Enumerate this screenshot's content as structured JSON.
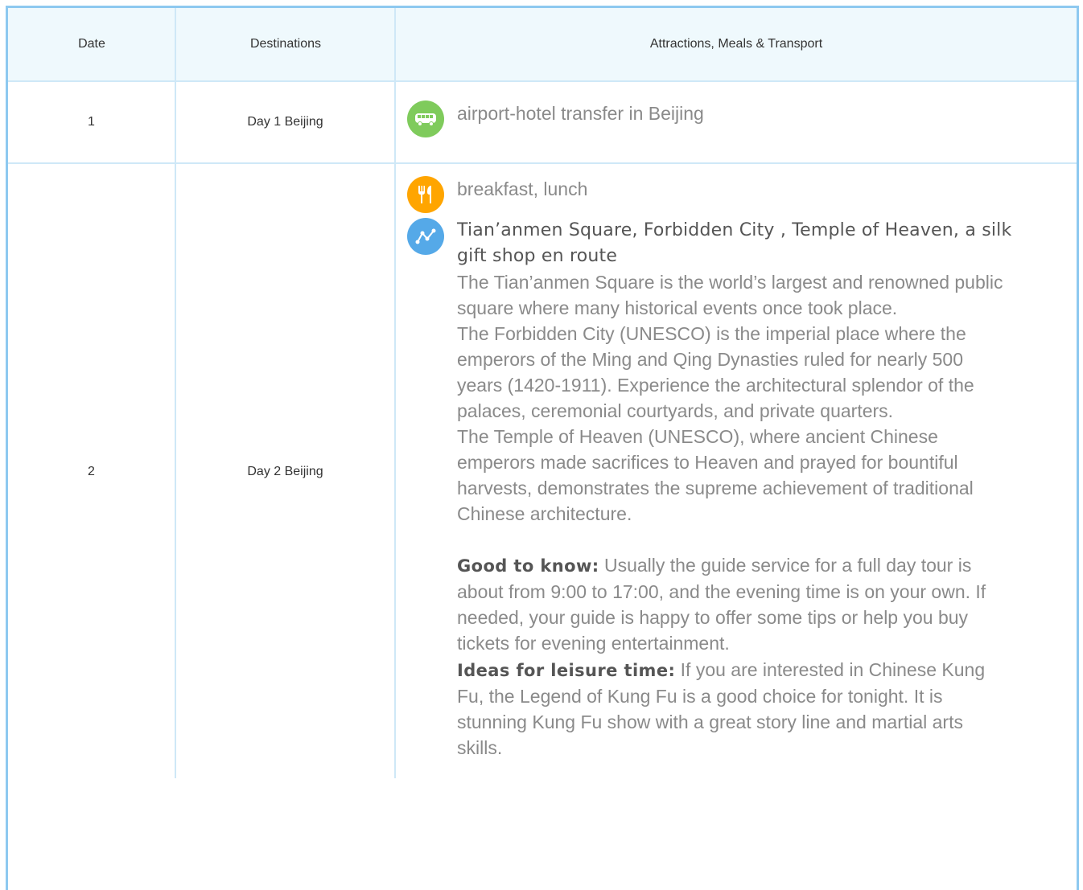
{
  "table": {
    "headers": [
      "Date",
      "Destinations",
      "Attractions, Meals & Transport"
    ],
    "rows": [
      {
        "date": "1",
        "destination": "Day 1 Beijing",
        "transfer_icon": "bus-icon",
        "transfer": "airport-hotel transfer in Beijing"
      },
      {
        "date": "2",
        "destination": "Day 2 Beijing",
        "meals_icon": "fork-knife-icon",
        "meals": "breakfast, lunch",
        "route_icon": "route-icon",
        "sights_title": "Tian’anmen Square, Forbidden City , Temple of Heaven, a silk gift shop en route",
        "description": "The Tian’anmen Square is the world’s largest and renowned public square where many historical events once took place.\nThe Forbidden City (UNESCO) is the imperial place where the emperors of the Ming and Qing Dynasties ruled for nearly 500 years (1420-1911). Experience the architectural splendor of the palaces, ceremonial courtyards, and private quarters.\nThe Temple of Heaven (UNESCO), where ancient Chinese emperors made sacrifices to Heaven and prayed for bountiful harvests, demonstrates the supreme achievement of traditional Chinese architecture.",
        "good_to_know_label": "Good to know:",
        "good_to_know_text": "Usually the guide service for a full day tour is about from 9:00 to 17:00, and the evening time is on your own. If needed, your guide is happy to offer some tips or help you buy tickets for evening entertainment.",
        "leisure_label": "Ideas for leisure time:",
        "leisure_text": "If you are interested in Chinese Kung Fu, the Legend of Kung Fu is a good choice for tonight. It is stunning Kung Fu show with a great story line and martial arts skills."
      }
    ]
  },
  "colors": {
    "border": "#8ec9f0",
    "header_bg": "#eff9fd",
    "transfer_icon": "#7fcb5c",
    "meals_icon": "#ffa500",
    "route_icon": "#55a9e8"
  }
}
